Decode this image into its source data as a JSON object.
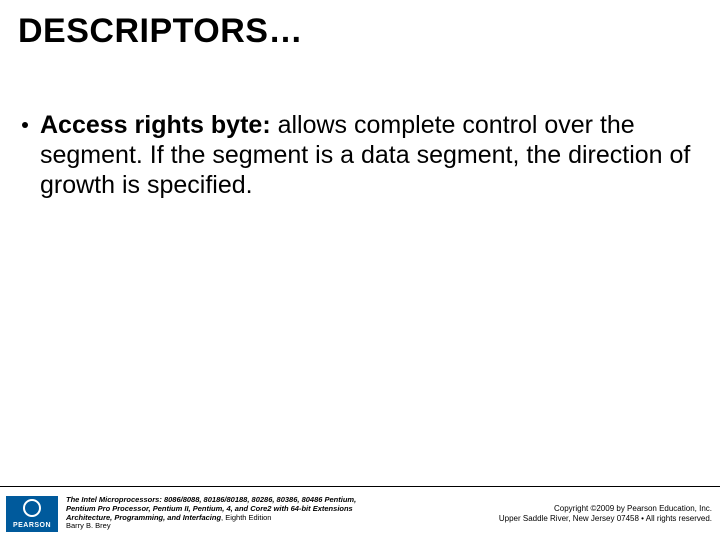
{
  "title": "DESCRIPTORS…",
  "bullet": {
    "lead": "Access rights byte:",
    "rest": " allows complete control over the segment. If the segment is a data segment, the direction of growth is specified."
  },
  "footer": {
    "logo_text": "PEARSON",
    "book_line1": "The Intel Microprocessors: 8086/8088, 80186/80188, 80286, 80386, 80486 Pentium,",
    "book_line2": "Pentium Pro Processor, Pentium II, Pentium, 4, and Core2 with 64-bit Extensions",
    "book_line3_italic": "Architecture, Programming, and Interfacing",
    "book_line3_plain": ", Eighth Edition",
    "book_line4": "Barry B. Brey",
    "copy_line1": "Copyright ©2009 by Pearson Education, Inc.",
    "copy_line2": "Upper Saddle River, New Jersey 07458 • All rights reserved."
  }
}
